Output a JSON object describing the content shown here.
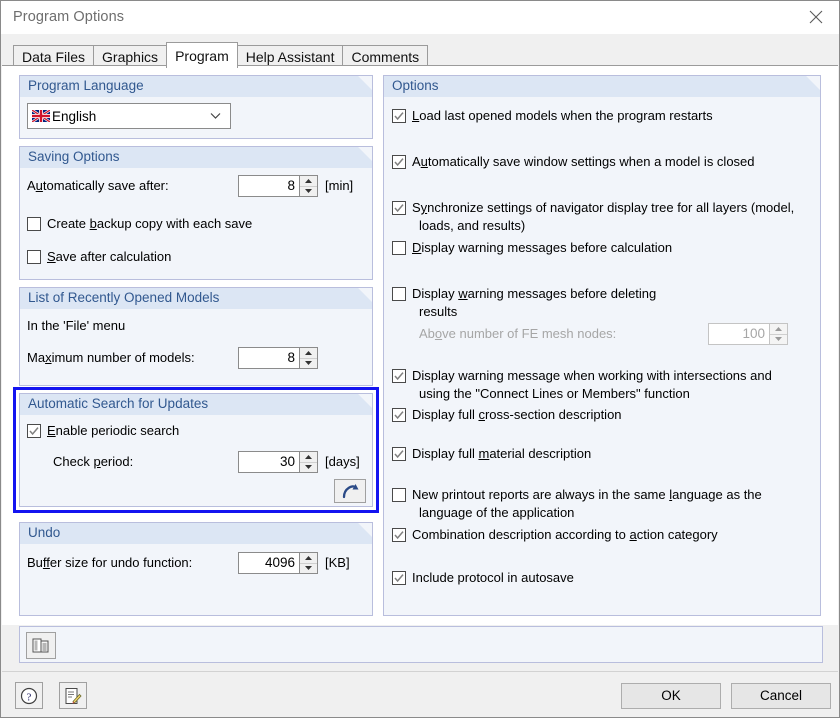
{
  "window": {
    "title": "Program Options",
    "close_icon": "close-icon"
  },
  "tabs": [
    {
      "label": "Data Files",
      "active": false
    },
    {
      "label": "Graphics",
      "active": false
    },
    {
      "label": "Program",
      "active": true
    },
    {
      "label": "Help Assistant",
      "active": false
    },
    {
      "label": "Comments",
      "active": false
    }
  ],
  "left": {
    "program_language": {
      "title": "Program Language",
      "combo_value": "English",
      "flag_icon": "uk-flag-icon",
      "chevron_icon": "chevron-down-icon"
    },
    "saving_options": {
      "title": "Saving Options",
      "autosave_label_pre": "A",
      "autosave_label_key": "u",
      "autosave_label_post": "tomatically save after:",
      "autosave_value": "8",
      "autosave_unit": "[min]",
      "backup_pre": "Create ",
      "backup_key": "b",
      "backup_post": "ackup copy with each save",
      "backup_checked": false,
      "save_after_calc_key": "S",
      "save_after_calc_post": "ave after calculation",
      "save_after_calc_checked": false
    },
    "recent_models": {
      "title": "List of Recently Opened Models",
      "menu_note": "In the 'File' menu",
      "max_label_pre": "Ma",
      "max_label_key": "x",
      "max_label_post": "imum number of models:",
      "max_value": "8"
    },
    "auto_update": {
      "title": "Automatic Search for Updates",
      "enable_key": "E",
      "enable_post": "nable periodic search",
      "enable_checked": true,
      "check_period_pre": "Check ",
      "check_period_key": "p",
      "check_period_post": "eriod:",
      "check_period_value": "30",
      "check_period_unit": "[days]",
      "search_now_icon": "refresh-arrow-icon",
      "highlight_color": "#1414f0"
    },
    "undo": {
      "title": "Undo",
      "buffer_label_pre": "Bu",
      "buffer_label_key": "ff",
      "buffer_label_post": "er size for undo function:",
      "buffer_value": "4096",
      "buffer_unit": "[KB]"
    }
  },
  "right": {
    "title": "Options",
    "items": [
      {
        "checked": true,
        "pre": "",
        "key": "L",
        "post": "oad last opened models when the program restarts",
        "line2": ""
      },
      {
        "checked": true,
        "pre": "A",
        "key": "u",
        "post": "tomatically save window settings when a model is closed",
        "line2": ""
      },
      {
        "checked": true,
        "pre": "S",
        "key": "y",
        "post": "nchronize settings of navigator display tree for all layers (model,",
        "line2": "loads, and results)"
      },
      {
        "checked": false,
        "pre": "",
        "key": "D",
        "post": "isplay warning messages before calculation",
        "line2": ""
      },
      {
        "checked": false,
        "pre": "Display ",
        "key": "w",
        "post": "arning messages before deleting",
        "line2": "results"
      },
      {
        "checked": true,
        "pre": "Display warning message when working with intersections and",
        "key": "",
        "post": "",
        "line2": "using the \"Connect Lines or Members\" function"
      },
      {
        "checked": true,
        "pre": "Display full ",
        "key": "c",
        "post": "ross-section description",
        "line2": ""
      },
      {
        "checked": true,
        "pre": "Display full ",
        "key": "m",
        "post": "aterial description",
        "line2": ""
      },
      {
        "checked": false,
        "pre": "New printout reports are always in the same ",
        "key": "l",
        "post": "anguage as the",
        "line2": "language of the application"
      },
      {
        "checked": true,
        "pre": "Combination description according to ",
        "key": "a",
        "post": "ction category",
        "line2": ""
      },
      {
        "checked": true,
        "pre": "Include protocol in autosave",
        "key": "",
        "post": "",
        "line2": ""
      }
    ],
    "fe_nodes": {
      "label_pre": "Ab",
      "label_key": "o",
      "label_post": "ve number of FE mesh nodes:",
      "value": "100",
      "disabled": true
    }
  },
  "toolbar": {
    "clipboard_icon": "clipboard-copy-icon"
  },
  "footer": {
    "help_icon": "help-question-icon",
    "edit_icon": "edit-note-icon",
    "ok_label": "OK",
    "cancel_label": "Cancel"
  }
}
